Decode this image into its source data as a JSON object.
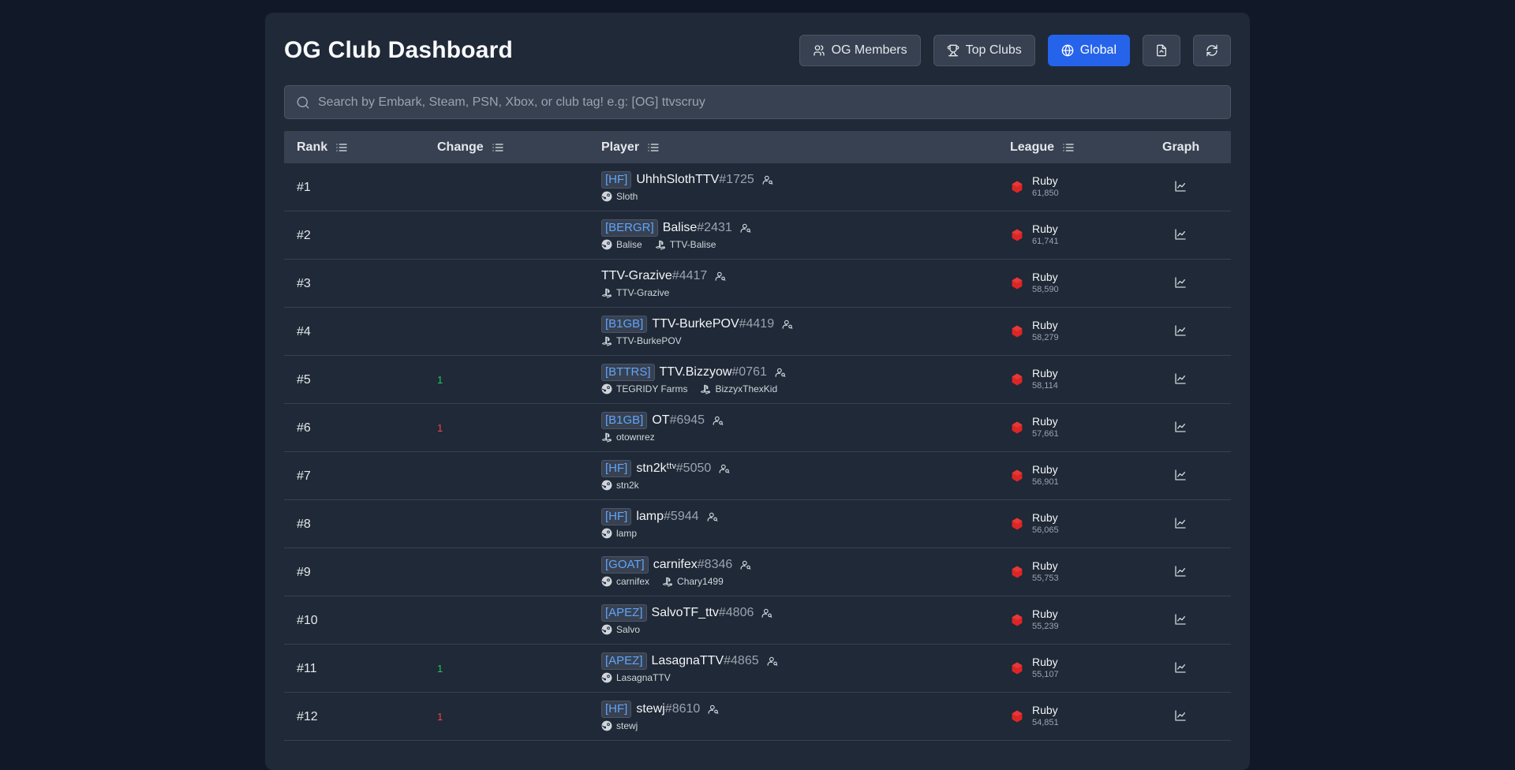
{
  "header": {
    "title": "OG Club Dashboard",
    "buttons": {
      "og_members": "OG Members",
      "top_clubs": "Top Clubs",
      "global": "Global"
    }
  },
  "search": {
    "placeholder": "Search by Embark, Steam, PSN, Xbox, or club tag! e.g: [OG] ttvscruy"
  },
  "columns": {
    "rank": "Rank",
    "change": "Change",
    "player": "Player",
    "league": "League",
    "graph": "Graph"
  },
  "colors": {
    "accent": "#2563eb",
    "ruby": "#dc2626",
    "up": "#22c55e",
    "down": "#ef4444",
    "tag": "#60a5fa"
  },
  "rows": [
    {
      "rank": "#1",
      "change": "",
      "dir": "",
      "tag": "[HF]",
      "name": "UhhhSlothTTV",
      "id": "#1725",
      "accounts": [
        {
          "type": "steam",
          "name": "Sloth"
        }
      ],
      "league": "Ruby",
      "points": "61,850"
    },
    {
      "rank": "#2",
      "change": "",
      "dir": "",
      "tag": "[BERGR]",
      "name": "Balise",
      "id": "#2431",
      "accounts": [
        {
          "type": "steam",
          "name": "Balise"
        },
        {
          "type": "psn",
          "name": "TTV-Balise"
        }
      ],
      "league": "Ruby",
      "points": "61,741"
    },
    {
      "rank": "#3",
      "change": "",
      "dir": "",
      "tag": "",
      "name": "TTV-Grazive",
      "id": "#4417",
      "accounts": [
        {
          "type": "psn",
          "name": "TTV-Grazive"
        }
      ],
      "league": "Ruby",
      "points": "58,590"
    },
    {
      "rank": "#4",
      "change": "",
      "dir": "",
      "tag": "[B1GB]",
      "name": "TTV-BurkePOV",
      "id": "#4419",
      "accounts": [
        {
          "type": "psn",
          "name": "TTV-BurkePOV"
        }
      ],
      "league": "Ruby",
      "points": "58,279"
    },
    {
      "rank": "#5",
      "change": "1",
      "dir": "up",
      "tag": "[BTTRS]",
      "name": "TTV.Bizzyow",
      "id": "#0761",
      "accounts": [
        {
          "type": "steam",
          "name": "TEGRIDY Farms"
        },
        {
          "type": "psn",
          "name": "BizzyxThexKid"
        }
      ],
      "league": "Ruby",
      "points": "58,114"
    },
    {
      "rank": "#6",
      "change": "1",
      "dir": "down",
      "tag": "[B1GB]",
      "name": "OT",
      "id": "#6945",
      "accounts": [
        {
          "type": "psn",
          "name": "otownrez"
        }
      ],
      "league": "Ruby",
      "points": "57,661"
    },
    {
      "rank": "#7",
      "change": "",
      "dir": "",
      "tag": "[HF]",
      "name": "stn2kᵗᵗᵛ",
      "id": "#5050",
      "accounts": [
        {
          "type": "steam",
          "name": "stn2k"
        }
      ],
      "league": "Ruby",
      "points": "56,901"
    },
    {
      "rank": "#8",
      "change": "",
      "dir": "",
      "tag": "[HF]",
      "name": "lamp",
      "id": "#5944",
      "accounts": [
        {
          "type": "steam",
          "name": "lamp"
        }
      ],
      "league": "Ruby",
      "points": "56,065"
    },
    {
      "rank": "#9",
      "change": "",
      "dir": "",
      "tag": "[GOAT]",
      "name": "carnifex",
      "id": "#8346",
      "accounts": [
        {
          "type": "steam",
          "name": "carnifex"
        },
        {
          "type": "psn",
          "name": "Chary1499"
        }
      ],
      "league": "Ruby",
      "points": "55,753"
    },
    {
      "rank": "#10",
      "change": "",
      "dir": "",
      "tag": "[APEZ]",
      "name": "SalvoTF_ttv",
      "id": "#4806",
      "accounts": [
        {
          "type": "steam",
          "name": "Salvo"
        }
      ],
      "league": "Ruby",
      "points": "55,239"
    },
    {
      "rank": "#11",
      "change": "1",
      "dir": "up",
      "tag": "[APEZ]",
      "name": "LasagnaTTV",
      "id": "#4865",
      "accounts": [
        {
          "type": "steam",
          "name": "LasagnaTTV"
        }
      ],
      "league": "Ruby",
      "points": "55,107"
    },
    {
      "rank": "#12",
      "change": "1",
      "dir": "down",
      "tag": "[HF]",
      "name": "stewj",
      "id": "#8610",
      "accounts": [
        {
          "type": "steam",
          "name": "stewj"
        }
      ],
      "league": "Ruby",
      "points": "54,851"
    }
  ]
}
